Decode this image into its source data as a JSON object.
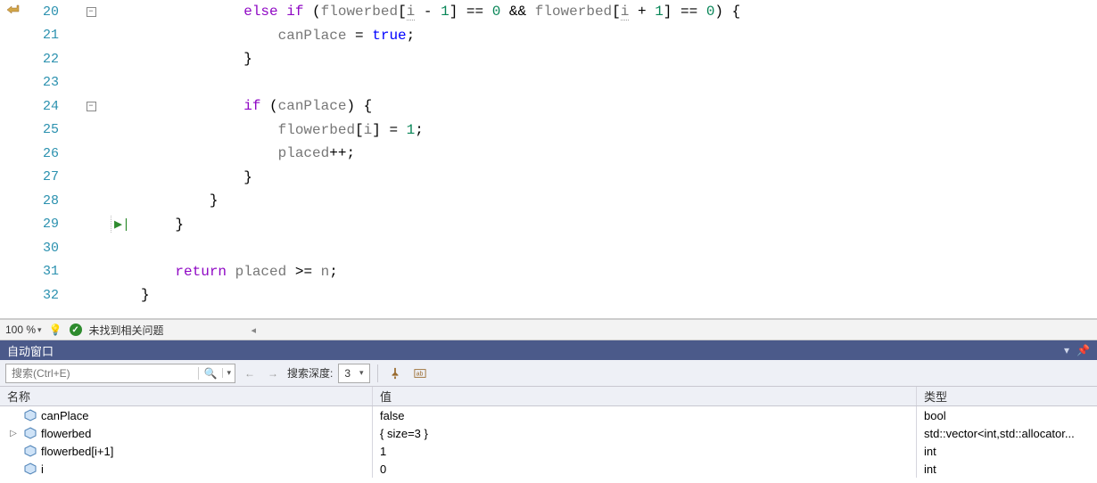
{
  "editor": {
    "lines": [
      {
        "no": 20,
        "fold": "minus",
        "gutterIcon": "return-arrow",
        "segs": [
          {
            "t": "            ",
            "c": ""
          },
          {
            "t": "else if",
            "c": "kwc"
          },
          {
            "t": " (",
            "c": ""
          },
          {
            "t": "flowerbed",
            "c": "var"
          },
          {
            "t": "[",
            "c": ""
          },
          {
            "t": "i",
            "c": "var dot-underline"
          },
          {
            "t": " - ",
            "c": ""
          },
          {
            "t": "1",
            "c": "num"
          },
          {
            "t": "] == ",
            "c": ""
          },
          {
            "t": "0",
            "c": "num"
          },
          {
            "t": " && ",
            "c": ""
          },
          {
            "t": "flowerbed",
            "c": "var"
          },
          {
            "t": "[",
            "c": ""
          },
          {
            "t": "i",
            "c": "var dot-underline"
          },
          {
            "t": " + ",
            "c": ""
          },
          {
            "t": "1",
            "c": "num"
          },
          {
            "t": "] == ",
            "c": ""
          },
          {
            "t": "0",
            "c": "num"
          },
          {
            "t": ") {",
            "c": ""
          }
        ]
      },
      {
        "no": 21,
        "segs": [
          {
            "t": "                ",
            "c": ""
          },
          {
            "t": "canPlace",
            "c": "var"
          },
          {
            "t": " = ",
            "c": ""
          },
          {
            "t": "true",
            "c": "kw"
          },
          {
            "t": ";",
            "c": ""
          }
        ]
      },
      {
        "no": 22,
        "segs": [
          {
            "t": "            }",
            "c": ""
          }
        ]
      },
      {
        "no": 23,
        "segs": [
          {
            "t": "",
            "c": ""
          }
        ]
      },
      {
        "no": 24,
        "fold": "minus",
        "segs": [
          {
            "t": "            ",
            "c": ""
          },
          {
            "t": "if",
            "c": "kwc"
          },
          {
            "t": " (",
            "c": ""
          },
          {
            "t": "canPlace",
            "c": "var"
          },
          {
            "t": ") {",
            "c": ""
          }
        ]
      },
      {
        "no": 25,
        "segs": [
          {
            "t": "                ",
            "c": ""
          },
          {
            "t": "flowerbed",
            "c": "var"
          },
          {
            "t": "[",
            "c": ""
          },
          {
            "t": "i",
            "c": "var"
          },
          {
            "t": "] = ",
            "c": ""
          },
          {
            "t": "1",
            "c": "num"
          },
          {
            "t": ";",
            "c": ""
          }
        ]
      },
      {
        "no": 26,
        "segs": [
          {
            "t": "                ",
            "c": ""
          },
          {
            "t": "placed",
            "c": "var"
          },
          {
            "t": "++;",
            "c": ""
          }
        ]
      },
      {
        "no": 27,
        "segs": [
          {
            "t": "            }",
            "c": ""
          }
        ]
      },
      {
        "no": 28,
        "segs": [
          {
            "t": "        }",
            "c": ""
          }
        ]
      },
      {
        "no": 29,
        "arrow": true,
        "segs": [
          {
            "t": "    }",
            "c": ""
          }
        ]
      },
      {
        "no": 30,
        "segs": [
          {
            "t": "",
            "c": ""
          }
        ]
      },
      {
        "no": 31,
        "segs": [
          {
            "t": "    ",
            "c": ""
          },
          {
            "t": "return",
            "c": "kwc"
          },
          {
            "t": " ",
            "c": ""
          },
          {
            "t": "placed",
            "c": "var"
          },
          {
            "t": " >= ",
            "c": ""
          },
          {
            "t": "n",
            "c": "var"
          },
          {
            "t": ";",
            "c": ""
          }
        ]
      },
      {
        "no": 32,
        "segs": [
          {
            "t": "}",
            "c": ""
          }
        ]
      }
    ]
  },
  "status": {
    "zoom": "100 %",
    "issuesText": "未找到相关问题"
  },
  "autos": {
    "panelTitle": "自动窗口",
    "searchPlaceholder": "搜索(Ctrl+E)",
    "depthLabel": "搜索深度:",
    "depthValue": "3",
    "headers": {
      "name": "名称",
      "value": "值",
      "type": "类型"
    },
    "rows": [
      {
        "expand": "",
        "name": "canPlace",
        "value": "false",
        "type": "bool"
      },
      {
        "expand": "▷",
        "name": "flowerbed",
        "value": "{ size=3 }",
        "type": "std::vector<int,std::allocator..."
      },
      {
        "expand": "",
        "name": "flowerbed[i+1]",
        "value": "1",
        "type": "int"
      },
      {
        "expand": "",
        "name": "i",
        "value": "0",
        "type": "int"
      }
    ]
  }
}
